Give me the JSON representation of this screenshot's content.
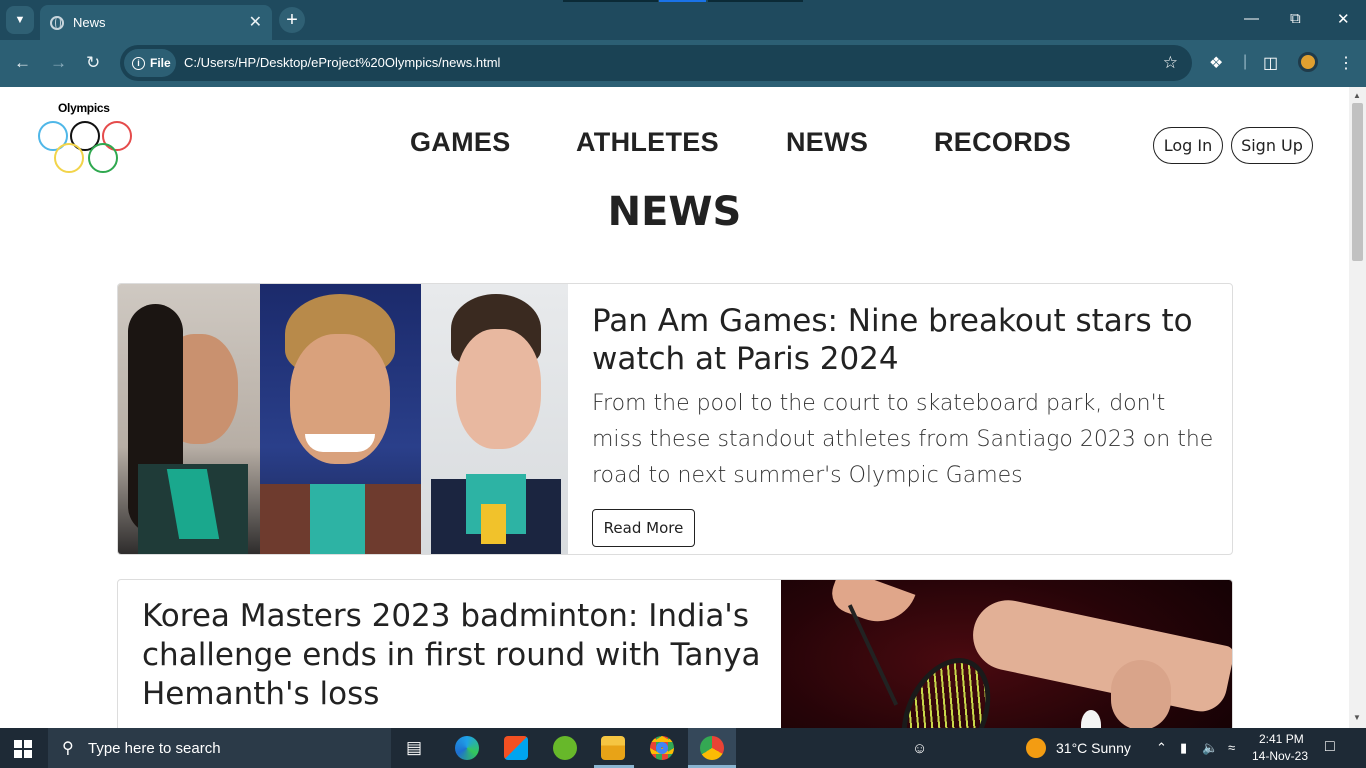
{
  "browser": {
    "tab_title": "News",
    "url_chip": "File",
    "url": "C:/Users/HP/Desktop/eProject%20Olympics/news.html"
  },
  "site": {
    "logo_text": "Olympics",
    "nav": [
      "GAMES",
      "ATHLETES",
      "NEWS",
      "RECORDS"
    ],
    "login_label": "Log In",
    "signup_label": "Sign Up",
    "page_heading": "NEWS",
    "ring_colors": [
      "#4fb7e8",
      "#111111",
      "#e54b4b",
      "#f2d44a",
      "#2fa84f"
    ]
  },
  "articles": [
    {
      "title": "Pan Am Games: Nine breakout stars to watch at Paris 2024",
      "text": "From the pool to the court to skateboard park, don't miss these standout athletes from Santiago 2023 on the road to next summer's Olympic Games",
      "button": "Read More",
      "image_alt": "athletes-photo"
    },
    {
      "title": "Korea Masters 2023 badminton: India's challenge ends in first round with Tanya Hemanth's loss",
      "image_alt": "badminton-photo"
    }
  ],
  "taskbar": {
    "search_placeholder": "Type here to search",
    "weather": "31°C  Sunny",
    "time": "2:41 PM",
    "date": "14-Nov-23"
  }
}
